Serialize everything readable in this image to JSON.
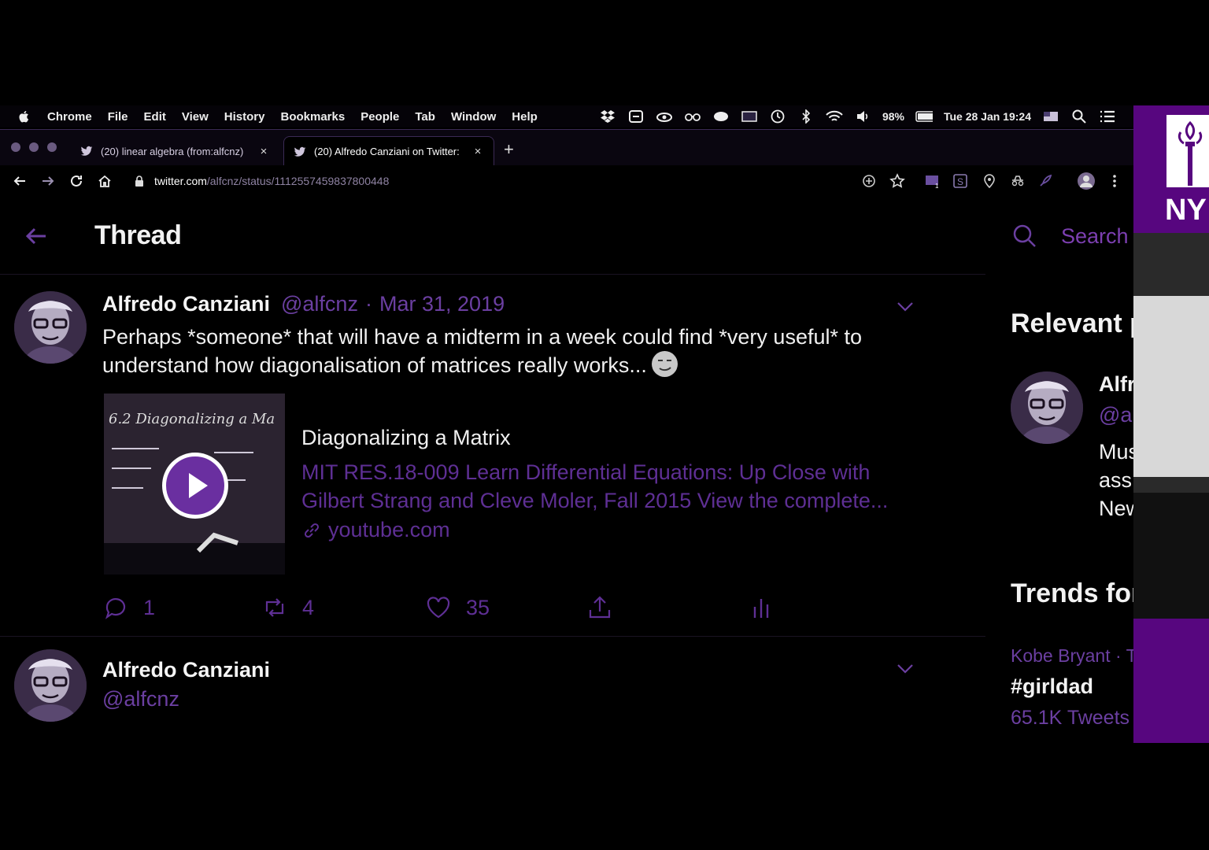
{
  "menubar": {
    "app_name": "Chrome",
    "items": [
      "File",
      "Edit",
      "View",
      "History",
      "Bookmarks",
      "People",
      "Tab",
      "Window",
      "Help"
    ],
    "battery": "98%",
    "clock": "Tue 28 Jan 19:24"
  },
  "tabs": [
    {
      "title": "(20) linear algebra (from:alfcnz)",
      "close": "×"
    },
    {
      "title": "(20) Alfredo Canziani on Twitter:",
      "close": "×"
    }
  ],
  "newtab": "+",
  "address": {
    "host": "twitter.com",
    "path": "/alfcnz/status/1112557459837800448"
  },
  "header": {
    "title": "Thread",
    "search_placeholder": "Search"
  },
  "tweet": {
    "name": "Alfredo Canziani",
    "handle": "@alfcnz",
    "separator": "·",
    "date": "Mar 31, 2019",
    "text": "Perhaps *someone* that will have a midterm in a week could find *very useful* to understand how diagonalisation of matrices really works...",
    "card": {
      "title": "Diagonalizing a Matrix",
      "description": "MIT RES.18-009 Learn Differential Equations: Up Close with Gilbert Strang and Cleve Moler, Fall 2015 View the complete...",
      "domain": "youtube.com",
      "thumb_text": "6.2 Diagonalizing a Ma"
    },
    "actions": {
      "replies": "1",
      "retweets": "4",
      "likes": "35"
    }
  },
  "reply": {
    "name": "Alfredo Canziani",
    "handle": "@alfcnz"
  },
  "sidebar": {
    "relevant_title": "Relevant people",
    "person_name": "Alfr",
    "person_handle": "@al",
    "bio_lines": [
      "Mus",
      "ass",
      "New"
    ],
    "trends_title": "Trends for you",
    "trend_meta": "Kobe Bryant · T",
    "trend_tag": "#girldad",
    "trend_count": "65.1K Tweets"
  },
  "slide": {
    "logo_text": "NY"
  },
  "colors": {
    "accent": "#6b3fa1",
    "accent_dark": "#5e2f94",
    "background": "#000000",
    "nyu_purple": "#57067f"
  }
}
